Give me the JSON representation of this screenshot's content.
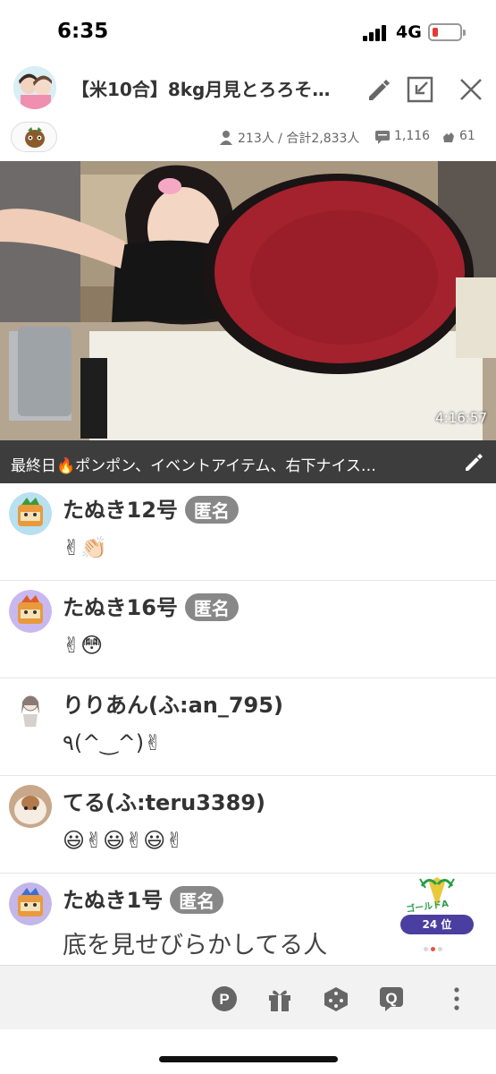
{
  "status_bar": {
    "time": "6:35",
    "network": "4G"
  },
  "header": {
    "title": "【米10合】8kg月見とろろそ…"
  },
  "stats": {
    "viewers": "213人 / 合計2,833人",
    "comments": "1,116",
    "claps": "61"
  },
  "video": {
    "timestamp": "4:16:57"
  },
  "description": {
    "text": "最終日🔥ポンポン、イベントアイテム、右下ナイス…"
  },
  "comments": [
    {
      "name": "たぬき12号",
      "badge": "匿名",
      "text": "✌👏🏻"
    },
    {
      "name": "たぬき16号",
      "badge": "匿名",
      "text": "✌😳"
    },
    {
      "name": "りりあん(ふ:an_795)",
      "badge": "",
      "text": "٩(^‿^)✌"
    },
    {
      "name": "てる(ふ:teru3389)",
      "badge": "",
      "text": "😃✌😃✌😃✌"
    },
    {
      "name": "たぬき1号",
      "badge": "匿名",
      "text": "底を見せびらかしてる人"
    }
  ],
  "rank": {
    "label": "ゴールドA",
    "position": "24 位"
  },
  "toolbar": {
    "point_label": "P",
    "question_label": "Q"
  },
  "colors": {
    "accent": "#4a3fa0",
    "badge": "#888888",
    "bowl": "#a3222d"
  }
}
